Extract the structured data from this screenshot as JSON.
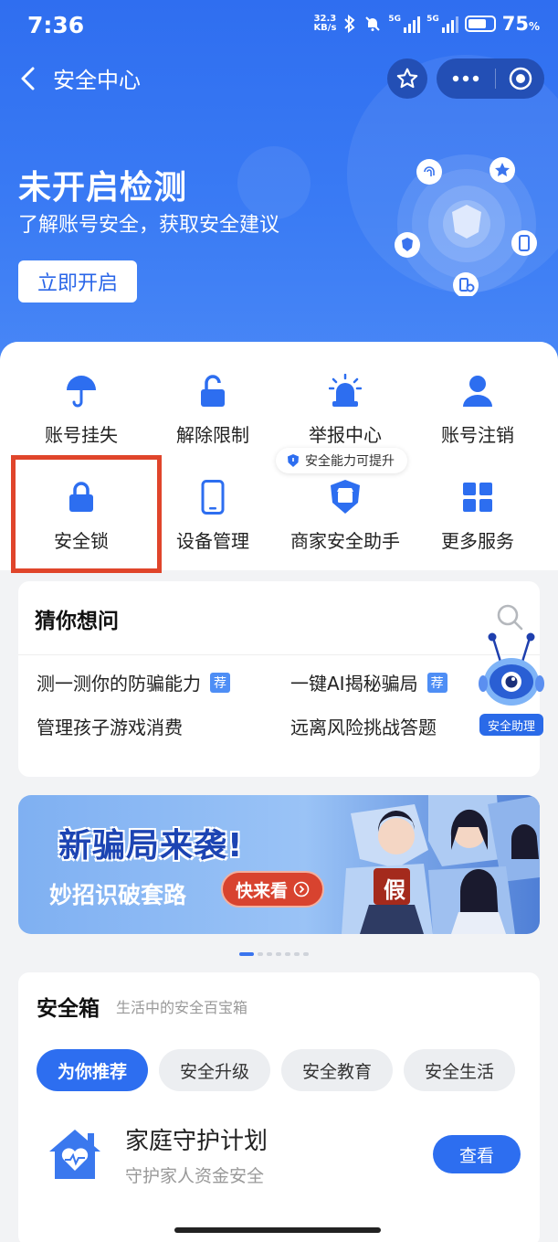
{
  "status_bar": {
    "time": "7:36",
    "net_speed": "32.3",
    "net_unit": "KB/s",
    "sig1": "5G",
    "sig2": "5G",
    "battery": "75",
    "battery_unit": "%"
  },
  "nav": {
    "title": "安全中心"
  },
  "hero": {
    "title": "未开启检测",
    "subtitle": "了解账号安全，获取安全建议",
    "button": "立即开启"
  },
  "grid": {
    "items": [
      {
        "label": "账号挂失",
        "icon": "umbrella-icon"
      },
      {
        "label": "解除限制",
        "icon": "unlock-icon"
      },
      {
        "label": "举报中心",
        "icon": "alarm-icon"
      },
      {
        "label": "账号注销",
        "icon": "user-icon"
      },
      {
        "label": "安全锁",
        "icon": "lock-icon"
      },
      {
        "label": "设备管理",
        "icon": "phone-icon"
      },
      {
        "label": "商家安全助手",
        "icon": "shop-shield-icon"
      },
      {
        "label": "更多服务",
        "icon": "grid-icon"
      }
    ],
    "badge": "安全能力可提升"
  },
  "guess": {
    "title": "猜你想问",
    "questions": [
      {
        "text": "测一测你的防骗能力",
        "tag": "荐"
      },
      {
        "text": "一键AI揭秘骗局",
        "tag": "荐"
      },
      {
        "text": "管理孩子游戏消费"
      },
      {
        "text": "远离风险挑战答题"
      }
    ],
    "assistant_label": "安全助理"
  },
  "banner": {
    "title": "新骗局来袭!",
    "subtitle": "妙招识破套路",
    "button": "快来看",
    "stamp": "假"
  },
  "safebox": {
    "title": "安全箱",
    "subtitle": "生活中的安全百宝箱",
    "tabs": [
      "为你推荐",
      "安全升级",
      "安全教育",
      "安全生活"
    ],
    "item": {
      "title": "家庭守护计划",
      "subtitle": "守护家人资金安全",
      "button": "查看"
    }
  },
  "colors": {
    "primary": "#2d6ef0",
    "highlight": "#e0452b",
    "banner_button": "#d8432f"
  }
}
